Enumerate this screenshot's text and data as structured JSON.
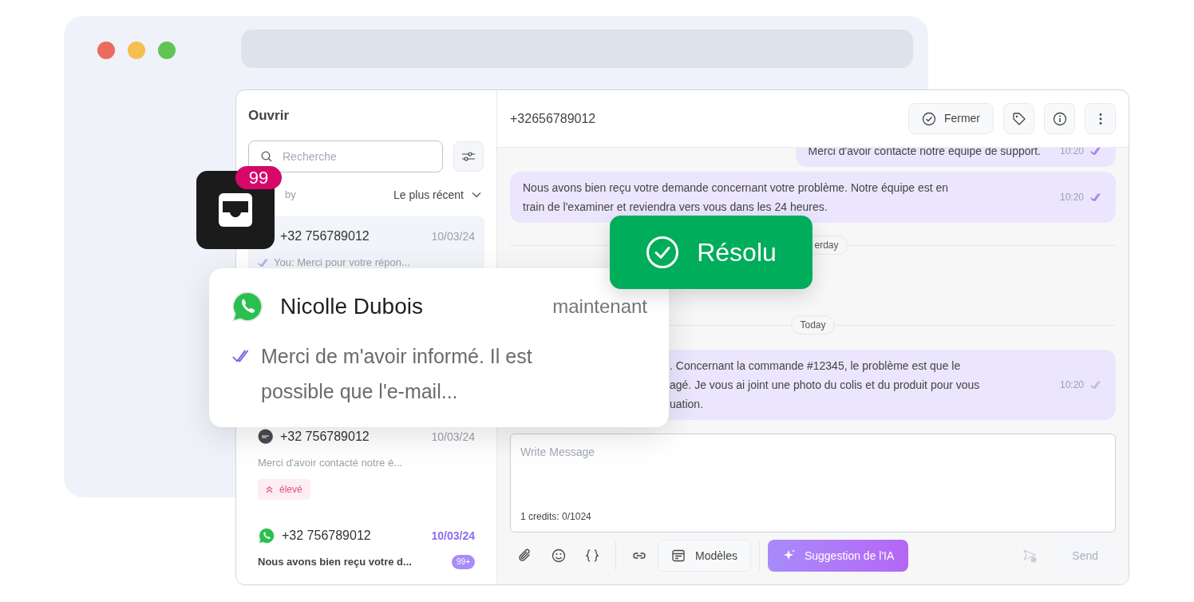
{
  "window_controls": [
    {
      "color": "#ec6a5e"
    },
    {
      "color": "#f4bf4f"
    },
    {
      "color": "#61c554"
    }
  ],
  "sidebar": {
    "title": "Ouvrir",
    "search": {
      "placeholder": "Recherche"
    },
    "sort_label": "by",
    "sort_value": "Le plus récent",
    "conversations": [
      {
        "phone": "+32 756789012",
        "date": "10/03/24",
        "preview": "You: Merci pour votre répon...",
        "sent": true,
        "selected": true,
        "unread": false
      },
      {
        "kind": "sms",
        "phone": "+32 756789012",
        "date": "10/03/24",
        "preview": "Merci d'avoir contacté notre é...",
        "sent": false,
        "selected": false,
        "unread": false,
        "tag": "élevé"
      },
      {
        "kind": "whatsapp",
        "phone": "+32 756789012",
        "date": "10/03/24",
        "preview": "Nous avons bien reçu votre d...",
        "sent": false,
        "selected": false,
        "unread": true,
        "badge": "99+"
      }
    ]
  },
  "chat": {
    "title": "+32656789012",
    "actions": [
      {
        "kind": "close",
        "label": "Fermer"
      },
      {
        "kind": "tag"
      },
      {
        "kind": "info"
      },
      {
        "kind": "more"
      }
    ],
    "messages": [
      {
        "kind": "message",
        "lines": [
          "Merci d'avoir contacté notre équipe de support."
        ],
        "time": "10:20",
        "read": true
      },
      {
        "kind": "message",
        "lines": [
          "Nous avons bien reçu votre demande concernant votre problème. Notre équipe est en",
          "train de l'examiner et reviendra vers vous dans les 24 heures."
        ],
        "time": "10:20",
        "read": true
      },
      {
        "kind": "divider",
        "label": "erday"
      },
      {
        "kind": "divider",
        "label": "Today"
      },
      {
        "kind": "message",
        "lines": [
          ". Concernant la commande #12345, le problème est que le",
          "agé. Je vous ai joint une photo du colis et du produit pour vous",
          "uation."
        ],
        "time": "10:20",
        "read": false
      }
    ],
    "composer": {
      "placeholder": "Write Message",
      "credits": "1 credits: 0/1024",
      "tools": [
        {
          "kind": "attach"
        },
        {
          "kind": "emoji"
        },
        {
          "kind": "variable"
        },
        {
          "kind": "separator"
        },
        {
          "kind": "link"
        },
        {
          "kind": "templates",
          "label": "Modèles"
        },
        {
          "kind": "separator"
        },
        {
          "kind": "ai",
          "label": "Suggestion de l'IA"
        },
        {
          "kind": "spacer"
        },
        {
          "kind": "schedule"
        },
        {
          "kind": "send",
          "label": "Send",
          "disabled": true
        }
      ]
    }
  },
  "inbox_badge": "99",
  "notification": {
    "name": "Nicolle Dubois",
    "time": "maintenant",
    "message": "Merci de m'avoir informé. Il est possible que l'e-mail...",
    "read": true
  },
  "status_toast": {
    "label": "Résolu"
  }
}
